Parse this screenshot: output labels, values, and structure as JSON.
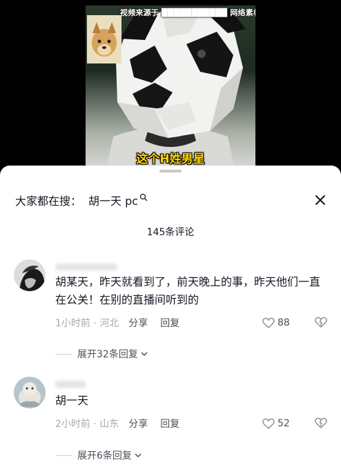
{
  "video": {
    "source_label": "视频来源于 ███████████ 网络素材",
    "caption": "这个H姓男星"
  },
  "search": {
    "prefix": "大家都在搜：",
    "term": "胡一天 pc",
    "icon": "search-icon"
  },
  "close_icon": "close-icon",
  "comments_header": {
    "count_label": "145条评论"
  },
  "comments": [
    {
      "text": "胡某天，昨天就看到了，前天晚上的事，昨天他们一直在公关！在别的直播间听到的",
      "meta": "1小时前 · 河北",
      "share_label": "分享",
      "reply_label": "回复",
      "likes": "88",
      "expand_label": "展开32条回复"
    },
    {
      "text": "胡一天",
      "meta": "2小时前 · 山东",
      "share_label": "分享",
      "reply_label": "回复",
      "likes": "52",
      "expand_label": "展开6条回复"
    }
  ]
}
